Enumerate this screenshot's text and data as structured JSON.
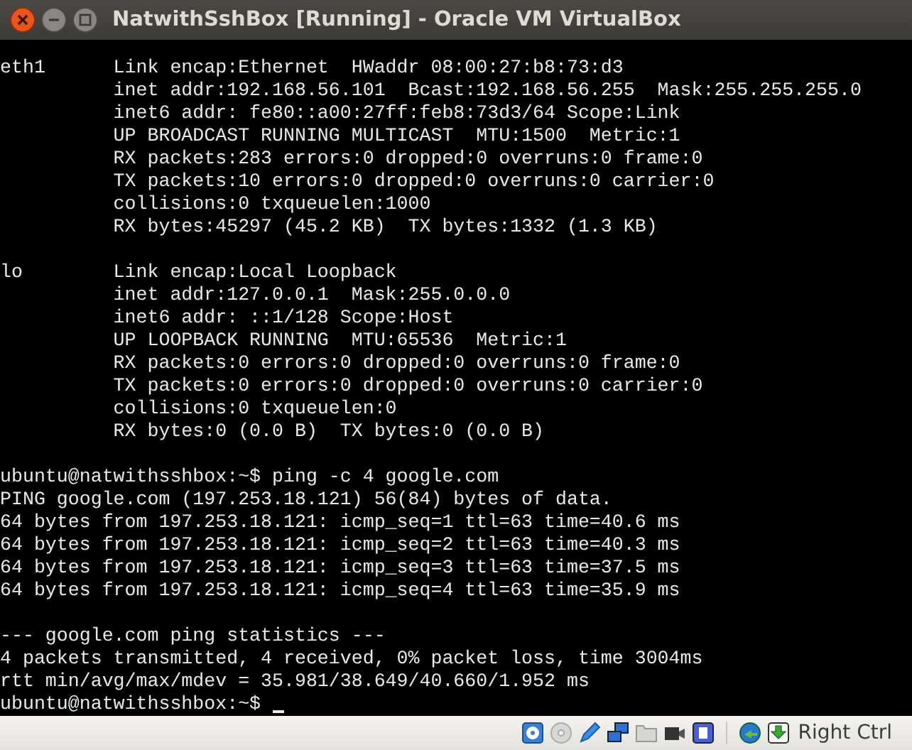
{
  "window": {
    "title": "NatwithSshBox [Running] - Oracle VM VirtualBox"
  },
  "terminal": {
    "blocks": [
      [
        "eth1      Link encap:Ethernet  HWaddr 08:00:27:b8:73:d3",
        "          inet addr:192.168.56.101  Bcast:192.168.56.255  Mask:255.255.255.0",
        "          inet6 addr: fe80::a00:27ff:feb8:73d3/64 Scope:Link",
        "          UP BROADCAST RUNNING MULTICAST  MTU:1500  Metric:1",
        "          RX packets:283 errors:0 dropped:0 overruns:0 frame:0",
        "          TX packets:10 errors:0 dropped:0 overruns:0 carrier:0",
        "          collisions:0 txqueuelen:1000",
        "          RX bytes:45297 (45.2 KB)  TX bytes:1332 (1.3 KB)"
      ],
      [
        "lo        Link encap:Local Loopback",
        "          inet addr:127.0.0.1  Mask:255.0.0.0",
        "          inet6 addr: ::1/128 Scope:Host",
        "          UP LOOPBACK RUNNING  MTU:65536  Metric:1",
        "          RX packets:0 errors:0 dropped:0 overruns:0 frame:0",
        "          TX packets:0 errors:0 dropped:0 overruns:0 carrier:0",
        "          collisions:0 txqueuelen:0",
        "          RX bytes:0 (0.0 B)  TX bytes:0 (0.0 B)"
      ],
      [
        "ubuntu@natwithsshbox:~$ ping -c 4 google.com",
        "PING google.com (197.253.18.121) 56(84) bytes of data.",
        "64 bytes from 197.253.18.121: icmp_seq=1 ttl=63 time=40.6 ms",
        "64 bytes from 197.253.18.121: icmp_seq=2 ttl=63 time=40.3 ms",
        "64 bytes from 197.253.18.121: icmp_seq=3 ttl=63 time=37.5 ms",
        "64 bytes from 197.253.18.121: icmp_seq=4 ttl=63 time=35.9 ms"
      ],
      [
        "--- google.com ping statistics ---",
        "4 packets transmitted, 4 received, 0% packet loss, time 3004ms",
        "rtt min/avg/max/mdev = 35.981/38.649/40.660/1.952 ms",
        "ubuntu@natwithsshbox:~$"
      ]
    ]
  },
  "status_bar": {
    "host_key": "Right Ctrl"
  }
}
